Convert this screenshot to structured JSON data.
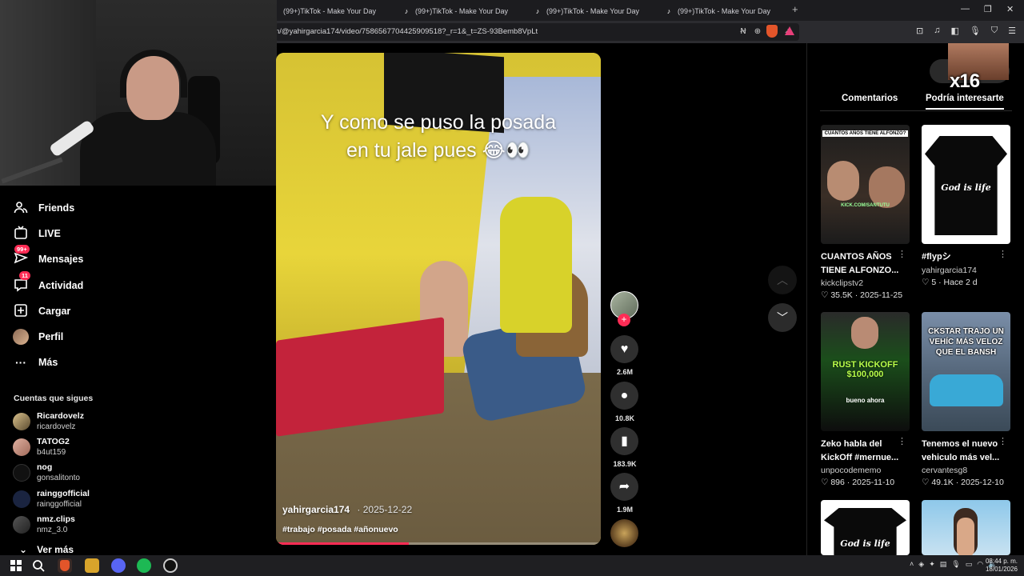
{
  "browser": {
    "tabs": [
      {
        "title": "(99+)TikTok - Make Your Day"
      },
      {
        "title": "(99+)TikTok - Make Your Day"
      },
      {
        "title": "(99+)TikTok - Make Your Day"
      },
      {
        "title": "(99+)TikTok - Make Your Day"
      }
    ],
    "url": "n/@yahirgarcia174/video/7586567704425909518?_r=1&_t=ZS-93Bemb8VpLt"
  },
  "sidebar": {
    "nav": [
      {
        "label": "Friends",
        "icon": "friends-icon"
      },
      {
        "label": "LIVE",
        "icon": "live-icon"
      },
      {
        "label": "Mensajes",
        "icon": "messages-icon",
        "badge": "99+"
      },
      {
        "label": "Actividad",
        "icon": "activity-icon",
        "badge": "11"
      },
      {
        "label": "Cargar",
        "icon": "upload-icon"
      },
      {
        "label": "Perfil",
        "icon": "profile-avatar"
      },
      {
        "label": "Más",
        "icon": "more-icon"
      }
    ],
    "following_title": "Cuentas que sigues",
    "following": [
      {
        "name": "Ricardovelz",
        "user": "ricardovelz"
      },
      {
        "name": "TATOG2",
        "user": "b4ut159"
      },
      {
        "name": "nog",
        "user": "gonsalitonto"
      },
      {
        "name": "rainggofficial",
        "user": "rainggofficial"
      },
      {
        "name": "nmz.clips",
        "user": "nmz_3.0"
      }
    ],
    "see_more": "Ver más"
  },
  "video": {
    "caption_line1": "Y como se puso la posada",
    "caption_line2": "en tu jale pues 😂👀",
    "author": "yahirgarcia174",
    "date": "2025-12-22",
    "hashtags": "#trabajo #posada #añonuevo",
    "progress": 0.41
  },
  "actions": {
    "likes": "2.6M",
    "comments": "10.8K",
    "saves": "183.9K",
    "shares": "1.9M"
  },
  "right_panel": {
    "overlay_text": "x16",
    "tabs": [
      "Comentarios",
      "Podría interesarte"
    ],
    "cards": [
      {
        "title": "CUANTOS AÑOS\nTIENE ALFONZO...",
        "author": "kickclipstv2",
        "likes": "35.5K",
        "date": "2025-11-25",
        "thumb_text": "CUANTOS AÑOS TIENE ALFONZO?",
        "thumb_sub": "KICK.COM/SANTUTU"
      },
      {
        "title": "#flypシ",
        "author": "yahirgarcia174",
        "likes": "5",
        "date": "Hace 2 d",
        "thumb_text": "God is life"
      },
      {
        "title": "Zeko habla del\nKickOff #mernue...",
        "author": "unpocodememo",
        "likes": "896",
        "date": "2025-11-10",
        "thumb_text": "RUST KICKOFF $100,000",
        "thumb_sub": "bueno ahora"
      },
      {
        "title": "Tenemos el nuevo\nvehiculo más vel...",
        "author": "cervantesg8",
        "likes": "49.1K",
        "date": "2025-12-10",
        "thumb_text": "CKSTAR TRAJO UN VEHÍC MÁS VELOZ QUE EL BANSH"
      },
      {
        "title": "",
        "author": "",
        "likes": "",
        "date": "",
        "thumb_text": "God is life"
      },
      {
        "title": "",
        "author": "",
        "likes": "",
        "date": "",
        "thumb_text": ""
      }
    ]
  },
  "taskbar": {
    "time": "08:44 p. m.",
    "date": "18/01/2026"
  },
  "colors": {
    "accent": "#fe2c55",
    "background": "#000000"
  }
}
